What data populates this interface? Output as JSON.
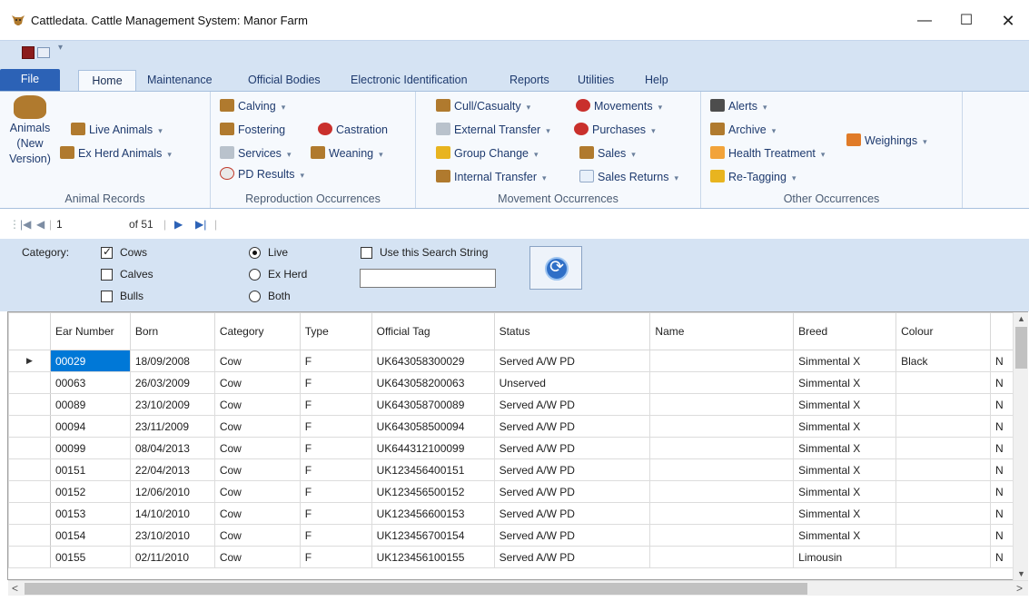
{
  "window": {
    "title": "Cattledata. Cattle Management System: Manor Farm",
    "min_glyph": "—",
    "max_glyph": "☐",
    "close_glyph": "✕"
  },
  "quick_access": {
    "dropdown_glyph": "▾"
  },
  "ribbon_tabs": {
    "file": "File",
    "home": "Home",
    "maintenance": "Maintenance",
    "official_bodies": "Official Bodies",
    "eid": "Electronic Identification",
    "reports": "Reports",
    "utilities": "Utilities",
    "help": "Help"
  },
  "ribbon": {
    "animal_records": {
      "label": "Animal Records",
      "animals_new": "Animals (New Version)",
      "live_animals": "Live Animals",
      "ex_herd": "Ex Herd Animals"
    },
    "reproduction": {
      "label": "Reproduction Occurrences",
      "calving": "Calving",
      "fostering": "Fostering",
      "services": "Services",
      "pd_results": "PD Results",
      "castration": "Castration",
      "weaning": "Weaning"
    },
    "movement": {
      "label": "Movement Occurrences",
      "cull": "Cull/Casualty",
      "external": "External Transfer",
      "group_change": "Group Change",
      "internal": "Internal Transfer",
      "movements": "Movements",
      "purchases": "Purchases",
      "sales": "Sales",
      "sales_returns": "Sales Returns"
    },
    "other": {
      "label": "Other Occurrences",
      "alerts": "Alerts",
      "archive": "Archive",
      "health": "Health Treatment",
      "retagging": "Re-Tagging",
      "weighings": "Weighings"
    },
    "dropdown_glyph": "▾"
  },
  "navigator": {
    "position": "1",
    "of_count": "of 51",
    "first_glyph": "|◀",
    "prev_glyph": "◀",
    "next_glyph": "▶",
    "last_glyph": "▶|"
  },
  "filter": {
    "category_label": "Category:",
    "cows": "Cows",
    "cows_checked": true,
    "calves": "Calves",
    "calves_checked": false,
    "bulls": "Bulls",
    "bulls_checked": false,
    "live": "Live",
    "ex_herd": "Ex Herd",
    "both": "Both",
    "selected_status": "Live",
    "use_search": "Use this Search String",
    "use_search_checked": false,
    "search_value": ""
  },
  "grid": {
    "columns": [
      "Ear Number",
      "Born",
      "Category",
      "Type",
      "Official Tag",
      "Status",
      "Name",
      "Breed",
      "Colour",
      ""
    ],
    "current_row_glyph": "▶",
    "rows": [
      [
        "00029",
        "18/09/2008",
        "Cow",
        "F",
        "UK643058300029",
        "Served A/W PD",
        "",
        "Simmental X",
        "Black",
        "N"
      ],
      [
        "00063",
        "26/03/2009",
        "Cow",
        "F",
        "UK643058200063",
        "Unserved",
        "",
        "Simmental X",
        "",
        "N"
      ],
      [
        "00089",
        "23/10/2009",
        "Cow",
        "F",
        "UK643058700089",
        "Served A/W PD",
        "",
        "Simmental X",
        "",
        "N"
      ],
      [
        "00094",
        "23/11/2009",
        "Cow",
        "F",
        "UK643058500094",
        "Served A/W PD",
        "",
        "Simmental X",
        "",
        "N"
      ],
      [
        "00099",
        "08/04/2013",
        "Cow",
        "F",
        "UK644312100099",
        "Served A/W PD",
        "",
        "Simmental X",
        "",
        "N"
      ],
      [
        "00151",
        "22/04/2013",
        "Cow",
        "F",
        "UK123456400151",
        "Served A/W PD",
        "",
        "Simmental X",
        "",
        "N"
      ],
      [
        "00152",
        "12/06/2010",
        "Cow",
        "F",
        "UK123456500152",
        "Served A/W PD",
        "",
        "Simmental X",
        "",
        "N"
      ],
      [
        "00153",
        "14/10/2010",
        "Cow",
        "F",
        "UK123456600153",
        "Served A/W PD",
        "",
        "Simmental X",
        "",
        "N"
      ],
      [
        "00154",
        "23/10/2010",
        "Cow",
        "F",
        "UK123456700154",
        "Served A/W PD",
        "",
        "Simmental X",
        "",
        "N"
      ],
      [
        "00155",
        "02/11/2010",
        "Cow",
        "F",
        "UK123456100155",
        "Served A/W PD",
        "",
        "Limousin",
        "",
        "N"
      ]
    ]
  },
  "scroll": {
    "up_glyph": "▲",
    "down_glyph": "▼",
    "left_glyph": "<",
    "right_glyph": ">"
  }
}
